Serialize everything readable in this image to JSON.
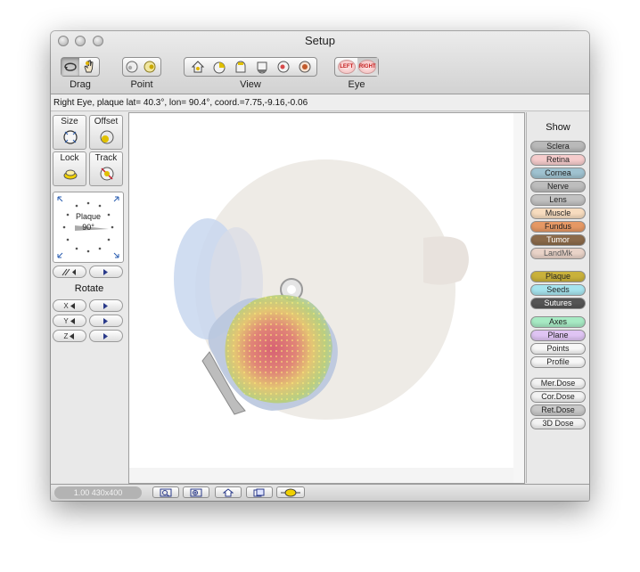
{
  "window": {
    "title": "Setup"
  },
  "toolbar": {
    "groups": [
      {
        "label": "Drag",
        "buttons": [
          "rotate-drag-icon",
          "hand-drag-icon"
        ]
      },
      {
        "label": "Point",
        "buttons": [
          "point-eye-icon",
          "point-plaque-icon"
        ]
      },
      {
        "label": "View",
        "buttons": [
          "view-front-icon",
          "view-side-icon",
          "view-top-icon",
          "view-bottom-icon",
          "view-back-icon",
          "view-center-icon"
        ]
      },
      {
        "label": "Eye",
        "buttons": [
          "LEFT",
          "RIGHT"
        ]
      }
    ]
  },
  "status": {
    "text": "Right Eye, plaque lat= 40.3°, lon= 90.4°, coord.=7.75,-9.16,-0.06"
  },
  "left_panel": {
    "size_label": "Size",
    "offset_label": "Offset",
    "lock_label": "Lock",
    "track_label": "Track",
    "dial_label": "Plaque",
    "dial_value": "90°",
    "rotate_label": "Rotate",
    "rotate_axes": [
      "X",
      "Y",
      "Z"
    ]
  },
  "show_panel": {
    "title": "Show",
    "groups": [
      [
        {
          "label": "Sclera",
          "color": "#b9b9b9",
          "text_color": "#222222"
        },
        {
          "label": "Retina",
          "color": "#f6cccc",
          "text_color": "#222222"
        },
        {
          "label": "Cornea",
          "color": "#9fc2d0",
          "text_color": "#222222"
        },
        {
          "label": "Nerve",
          "color": "#bdbdbd",
          "text_color": "#222222"
        },
        {
          "label": "Lens",
          "color": "#c2c2c2",
          "text_color": "#222222"
        },
        {
          "label": "Muscle",
          "color": "#f7dcbf",
          "text_color": "#222222"
        },
        {
          "label": "Fundus",
          "color": "#e59864",
          "text_color": "#222222"
        },
        {
          "label": "Tumor",
          "color": "#8b6a4a",
          "text_color": "#ffffff"
        },
        {
          "label": "LandMk",
          "color": "#e9d3c8",
          "text_color": "#555555"
        }
      ],
      [
        {
          "label": "Plaque",
          "color": "#c9b13b",
          "text_color": "#222222"
        },
        {
          "label": "Seeds",
          "color": "#a6e4ee",
          "text_color": "#222222"
        },
        {
          "label": "Sutures",
          "color": "#555555",
          "text_color": "#ffffff"
        }
      ],
      [
        {
          "label": "Axes",
          "color": "#a7eac4",
          "text_color": "#222222"
        },
        {
          "label": "Plane",
          "color": "#dfc4f3",
          "text_color": "#222222"
        },
        {
          "label": "Points",
          "color": "#f7f7f7",
          "text_color": "#222222"
        },
        {
          "label": "Profile",
          "color": "#f7f7f7",
          "text_color": "#222222"
        }
      ],
      [
        {
          "label": "Mer.Dose",
          "color": "#f3f3f3",
          "text_color": "#222222"
        },
        {
          "label": "Cor.Dose",
          "color": "#f3f3f3",
          "text_color": "#222222"
        },
        {
          "label": "Ret.Dose",
          "color": "#c9c9c9",
          "text_color": "#222222"
        },
        {
          "label": "3D Dose",
          "color": "#f3f3f3",
          "text_color": "#222222"
        }
      ]
    ]
  },
  "bottom_bar": {
    "zoom_readout": "1.00 430x400",
    "buttons": [
      "zoom-out-icon",
      "zoom-in-icon",
      "home-icon",
      "snapshot-icon",
      "dose-view-icon"
    ]
  }
}
